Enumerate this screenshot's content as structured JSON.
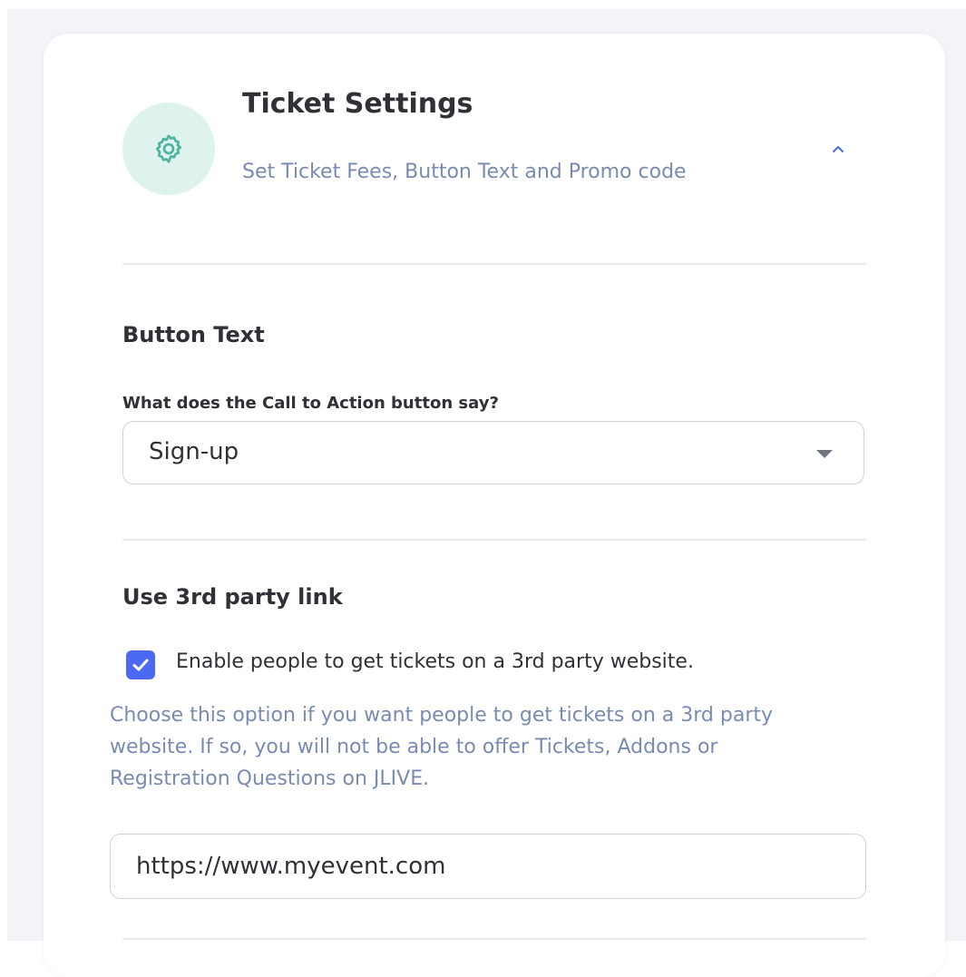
{
  "header": {
    "title": "Ticket Settings",
    "subtitle": "Set Ticket Fees, Button Text and Promo code",
    "icon": "gear-icon",
    "toggle_icon": "chevron-up-icon"
  },
  "button_text_section": {
    "heading": "Button Text",
    "field_label": "What does the Call to Action button say?",
    "selected_value": "Sign-up"
  },
  "third_party_section": {
    "heading": "Use 3rd party link",
    "checkbox_checked": true,
    "checkbox_label": "Enable people to get tickets on a 3rd party website.",
    "help_text": "Choose this option if you want people to get tickets on a 3rd party website. If so, you will not be able to offer Tickets, Addons or Registration Questions on JLIVE.",
    "url_value": "https://www.myevent.com"
  },
  "colors": {
    "accent": "#4c69f4",
    "icon_teal": "#4fb3a2",
    "icon_bg": "#dff3ee",
    "muted_text": "#7a8bb1",
    "text": "#2f3137"
  }
}
